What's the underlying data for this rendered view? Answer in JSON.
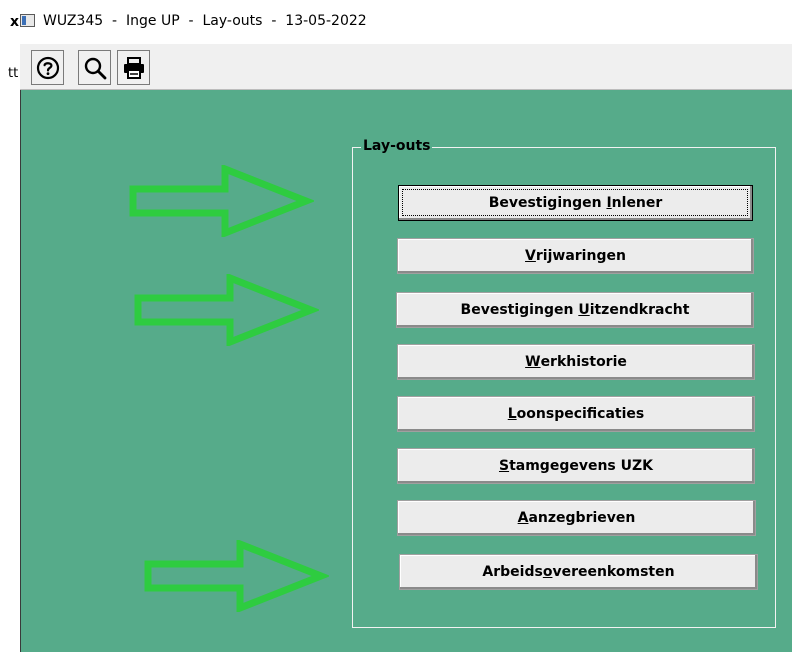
{
  "window": {
    "title": "WUZ345  -  Inge UP  -  Lay-outs  -  13-05-2022",
    "edge_text_top": "x",
    "edge_text_mid": "tt"
  },
  "toolbar": {
    "buttons": [
      {
        "name": "help",
        "icon": "help-icon"
      },
      {
        "name": "search",
        "icon": "search-icon"
      },
      {
        "name": "print",
        "icon": "printer-icon"
      }
    ]
  },
  "layouts": {
    "group_label": "Lay-outs",
    "buttons": [
      {
        "pre": "Bevestigingen ",
        "key": "I",
        "post": "nlener"
      },
      {
        "pre": "",
        "key": "V",
        "post": "rijwaringen"
      },
      {
        "pre": "Bevestigingen ",
        "key": "U",
        "post": "itzendkracht"
      },
      {
        "pre": "",
        "key": "W",
        "post": "erkhistorie"
      },
      {
        "pre": "",
        "key": "L",
        "post": "oonspecificaties"
      },
      {
        "pre": "",
        "key": "S",
        "post": "tamgegevens UZK"
      },
      {
        "pre": "",
        "key": "A",
        "post": "anzegbrieven"
      },
      {
        "pre": "Arbeids",
        "key": "o",
        "post": "vereenkomsten"
      }
    ]
  },
  "colors": {
    "background": "#56ab8a",
    "annotation_arrow": "#2ecc40",
    "button_face": "#ececec"
  }
}
